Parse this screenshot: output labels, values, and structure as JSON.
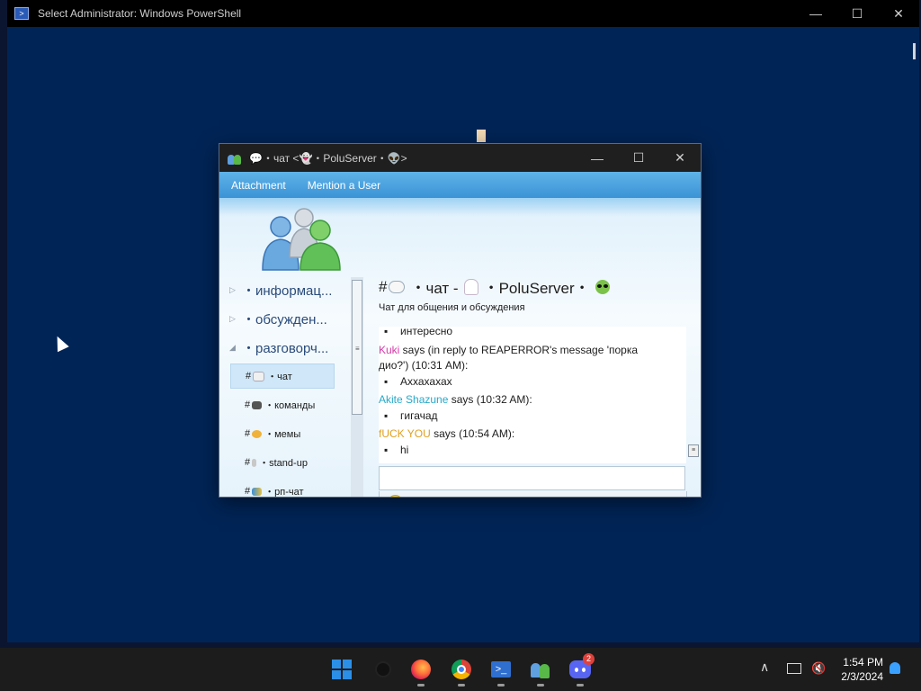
{
  "powershell": {
    "title": "Select Administrator: Windows PowerShell",
    "controls": {
      "minimize": "—",
      "maximize": "☐",
      "close": "✕"
    }
  },
  "messenger": {
    "title": "💬・чат <👻・PoluServer・👽>",
    "controls": {
      "minimize": "—",
      "maximize": "☐",
      "close": "✕"
    },
    "toolbar": {
      "attachment": "Attachment",
      "mention": "Mention a User"
    },
    "categories": [
      {
        "label": "・информац...",
        "expanded": false
      },
      {
        "label": "・обсужден...",
        "expanded": false
      },
      {
        "label": "・разговорч...",
        "expanded": true
      }
    ],
    "channels": [
      {
        "hash": "#",
        "emoji": "speech-bubble",
        "name": "・чат",
        "selected": true
      },
      {
        "hash": "#",
        "emoji": "gamepad",
        "name": "・команды",
        "selected": false
      },
      {
        "hash": "#",
        "emoji": "laughing-face",
        "name": "・мемы",
        "selected": false
      },
      {
        "hash": "#",
        "emoji": "microphone",
        "name": "・stand-up",
        "selected": false
      },
      {
        "hash": "#",
        "emoji": "cards",
        "name": "・рп-чат",
        "selected": false
      }
    ],
    "room": {
      "hash": "#",
      "name_part1": "・чат -",
      "name_part2": "・PoluServer・",
      "subtitle": "Чат для общения и обсуждения"
    },
    "chat": [
      {
        "type": "msg",
        "text": "интересно"
      },
      {
        "type": "header",
        "sender": "Kuki",
        "sender_color": "#d63aa8",
        "meta": " says (in reply to REAPERROR's message 'порка"
      },
      {
        "type": "cont",
        "text": "дио?') (10:31 AM):"
      },
      {
        "type": "msg",
        "text": "Аххахахах"
      },
      {
        "type": "header",
        "sender": "Akite Shazune",
        "sender_color": "#27a8c8",
        "meta": " says (10:32 AM):"
      },
      {
        "type": "msg",
        "text": "гигачад"
      },
      {
        "type": "header",
        "sender": "fUCK YOU",
        "sender_color": "#e0a020",
        "meta": " says (10:54 AM):"
      },
      {
        "type": "msg",
        "text": "hi"
      }
    ],
    "input": {
      "value": "",
      "placeholder": ""
    }
  },
  "taskbar": {
    "apps": [
      "windows-start",
      "search",
      "firefox",
      "chrome",
      "powershell",
      "messenger",
      "discord"
    ],
    "discord_badge": "2",
    "time": "1:54 PM",
    "date": "2/3/2024"
  }
}
